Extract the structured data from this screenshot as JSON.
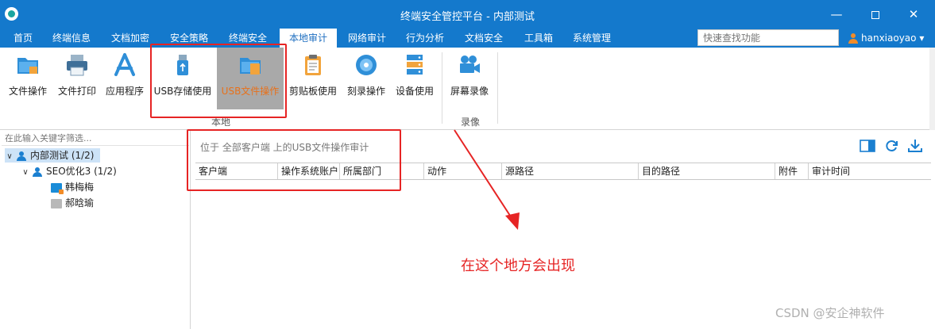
{
  "window": {
    "title": "终端安全管控平台 - 内部测试",
    "min_glyph": "—",
    "close_glyph": "✕"
  },
  "menu": {
    "items": [
      "首页",
      "终端信息",
      "文档加密",
      "安全策略",
      "终端安全",
      "本地审计",
      "网络审计",
      "行为分析",
      "文档安全",
      "工具箱",
      "系统管理"
    ],
    "active": "本地审计",
    "search_placeholder": "快速查找功能",
    "user": "hanxiaoyao",
    "user_caret": "▾"
  },
  "ribbon": {
    "buttons": [
      {
        "label": "文件操作",
        "icon": "folder-icon"
      },
      {
        "label": "文件打印",
        "icon": "printer-icon"
      },
      {
        "label": "应用程序",
        "icon": "app-store-icon"
      },
      {
        "label": "USB存储使用",
        "icon": "usb-drive-icon"
      },
      {
        "label": "USB文件操作",
        "icon": "usb-file-icon"
      },
      {
        "label": "剪贴板使用",
        "icon": "clipboard-icon"
      },
      {
        "label": "刻录操作",
        "icon": "disc-icon"
      },
      {
        "label": "设备使用",
        "icon": "server-icon"
      },
      {
        "label": "屏幕录像",
        "icon": "video-camera-icon"
      }
    ],
    "active": "USB文件操作",
    "groups": {
      "local": "本地",
      "record": "录像"
    }
  },
  "tree": {
    "filter_placeholder": "在此输入关键字筛选...",
    "root": "内部测试 (1/2)",
    "child": "SEO优化3 (1/2)",
    "clients": [
      {
        "name": "韩梅梅",
        "online": true
      },
      {
        "name": "郝晗瑜",
        "online": false
      }
    ],
    "expanded_glyph": "∨"
  },
  "main": {
    "breadcrumb": "位于 全部客户端 上的USB文件操作审计",
    "columns": [
      "客户端",
      "操作系统账户",
      "所属部门",
      "动作",
      "源路径",
      "目的路径",
      "附件",
      "审计时间"
    ]
  },
  "annotation": {
    "text": "在这个地方会出现",
    "color": "#e62424"
  },
  "watermark": "CSDN @安企神软件",
  "colors": {
    "primary": "#1479cc",
    "active_ribbon": "#a9a9a9",
    "active_label": "#e8711b",
    "selection": "#cde3f7"
  }
}
